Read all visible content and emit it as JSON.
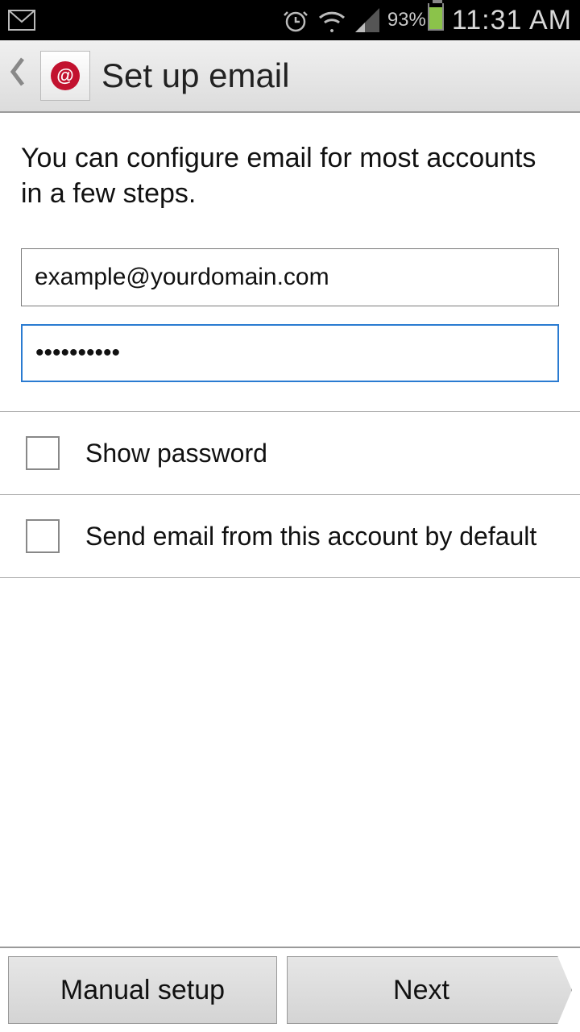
{
  "status": {
    "battery_percent": "93%",
    "time": "11:31 AM"
  },
  "header": {
    "title": "Set up email"
  },
  "intro": "You can configure email for most accounts in a few steps.",
  "fields": {
    "email_value": "example@yourdomain.com",
    "password_value": "••••••••••"
  },
  "options": {
    "show_password": "Show password",
    "default_account": "Send email from this account by default"
  },
  "buttons": {
    "manual": "Manual setup",
    "next": "Next"
  }
}
